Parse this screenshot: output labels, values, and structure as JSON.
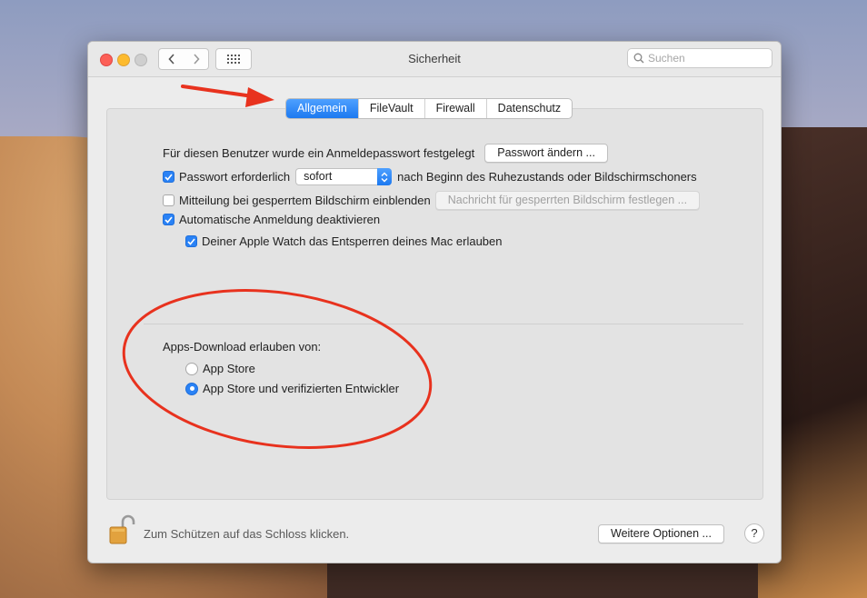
{
  "window": {
    "title": "Sicherheit",
    "search_placeholder": "Suchen"
  },
  "tabs": [
    {
      "label": "Allgemein",
      "active": true
    },
    {
      "label": "FileVault",
      "active": false
    },
    {
      "label": "Firewall",
      "active": false
    },
    {
      "label": "Datenschutz",
      "active": false
    }
  ],
  "general": {
    "password_set_text": "Für diesen Benutzer wurde ein Anmeldepasswort festgelegt",
    "change_password_button": "Passwort ändern ...",
    "require_password": {
      "label": "Passwort erforderlich",
      "checked": true,
      "select_value": "sofort",
      "suffix": "nach Beginn des Ruhezustands oder Bildschirmschoners"
    },
    "lock_message": {
      "label": "Mitteilung bei gesperrtem Bildschirm einblenden",
      "checked": false,
      "button": "Nachricht für gesperrten Bildschirm festlegen ..."
    },
    "disable_auto_login": {
      "label": "Automatische Anmeldung deaktivieren",
      "checked": true
    },
    "apple_watch": {
      "label": "Deiner Apple Watch das Entsperren deines Mac erlauben",
      "checked": true
    }
  },
  "apps_download": {
    "heading": "Apps-Download erlauben von:",
    "options": [
      {
        "label": "App Store",
        "selected": false
      },
      {
        "label": "App Store und verifizierten Entwickler",
        "selected": true
      }
    ]
  },
  "footer": {
    "lock_text": "Zum Schützen auf das Schloss klicken.",
    "more_options_button": "Weitere Optionen ...",
    "help_label": "?"
  },
  "colors": {
    "accent": "#1c79f0",
    "annotation": "#e8321e"
  }
}
